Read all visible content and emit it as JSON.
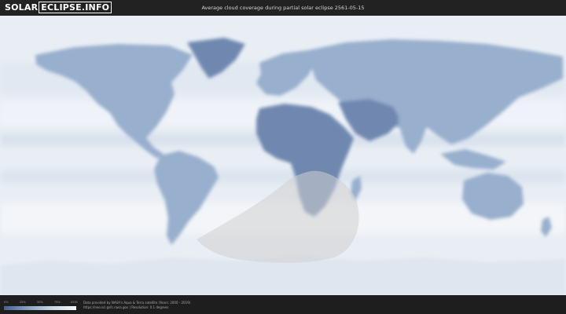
{
  "header": {
    "logo_part1": "SOLAR",
    "logo_part2": "ECLIPSE.INFO",
    "title": "Average cloud coverage during partial solar eclipse 2561-05-15"
  },
  "map": {
    "ocean_color": "#e9eef5",
    "cloud_light_color": "#f7f9fc",
    "land_color": "#98afcd",
    "dark_land_color": "#6f88b0",
    "eclipse_zone_color": "#cfcfcf",
    "antarctica_color": "#dfe6ef"
  },
  "legend": {
    "ticks": [
      "0%",
      "25%",
      "50%",
      "75%",
      "100%"
    ]
  },
  "footer": {
    "credit_line1": "Data provided by NASA's Aqua & Terra satellite (Years: 2000 - 2019)",
    "credit_line2": "https://neo.sci.gsfc.nasa.gov | Resolution: 0.1 degrees"
  }
}
